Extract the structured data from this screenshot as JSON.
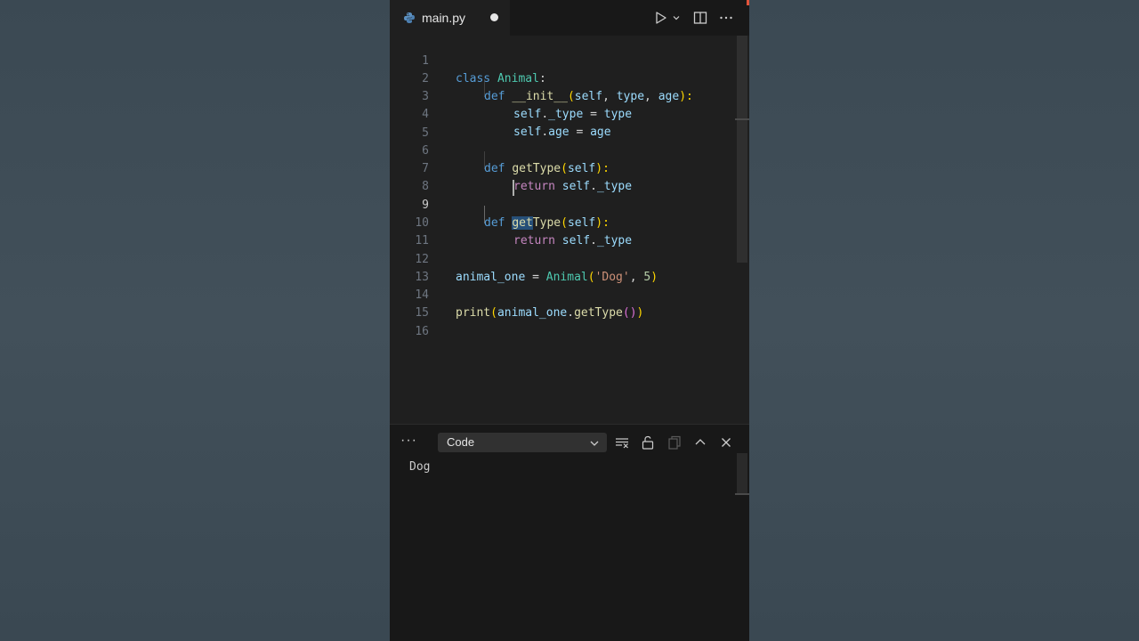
{
  "tab": {
    "filename": "main.py",
    "icon": "python-file-icon"
  },
  "toolbar": {
    "run_icon": "play-icon",
    "run_dropdown_icon": "chevron-down-icon",
    "split_icon": "split-editor-icon",
    "more_icon": "ellipsis-icon"
  },
  "editor": {
    "active_line": 9,
    "lines": [
      {
        "n": "1"
      },
      {
        "n": "2"
      },
      {
        "n": "3"
      },
      {
        "n": "4"
      },
      {
        "n": "5"
      },
      {
        "n": "6"
      },
      {
        "n": "7"
      },
      {
        "n": "8"
      },
      {
        "n": "9"
      },
      {
        "n": "10"
      },
      {
        "n": "11"
      },
      {
        "n": "12"
      },
      {
        "n": "13"
      },
      {
        "n": "14"
      },
      {
        "n": "15"
      },
      {
        "n": "16"
      }
    ],
    "tokens": {
      "l1": [
        "class",
        " ",
        "Animal",
        ":"
      ],
      "l2": [
        "def",
        " ",
        "__init__",
        "(",
        "self",
        ", ",
        "type",
        ", ",
        "age",
        "):"
      ],
      "l3": [
        "self",
        ".",
        "_type",
        " = ",
        "type"
      ],
      "l4": [
        "self",
        ".",
        "age",
        " = ",
        "age"
      ],
      "l6": [
        "def",
        " ",
        "getType",
        "(",
        "self",
        "):"
      ],
      "l7": [
        "return",
        " ",
        "self",
        ".",
        "_type"
      ],
      "l9": [
        "def",
        " ",
        "get",
        "Type",
        "(",
        "self",
        "):"
      ],
      "l10": [
        "return",
        " ",
        "self",
        ".",
        "_type"
      ],
      "l12": [
        "animal_one",
        " = ",
        "Animal",
        "(",
        "'Dog'",
        ", ",
        "5",
        ")"
      ],
      "l14": [
        "print",
        "(",
        "animal_one",
        ".",
        "getType",
        "()",
        ")"
      ]
    }
  },
  "panel": {
    "more_label": "···",
    "source_select": "Code",
    "icons": [
      "clear-output-icon",
      "lock-icon",
      "copy-icon",
      "maximize-panel-icon",
      "close-panel-icon"
    ],
    "output": "Dog"
  },
  "colors": {
    "accent": "#e2533a",
    "editor_bg": "#1f1f1f",
    "page_bg": "#3d4b55"
  }
}
